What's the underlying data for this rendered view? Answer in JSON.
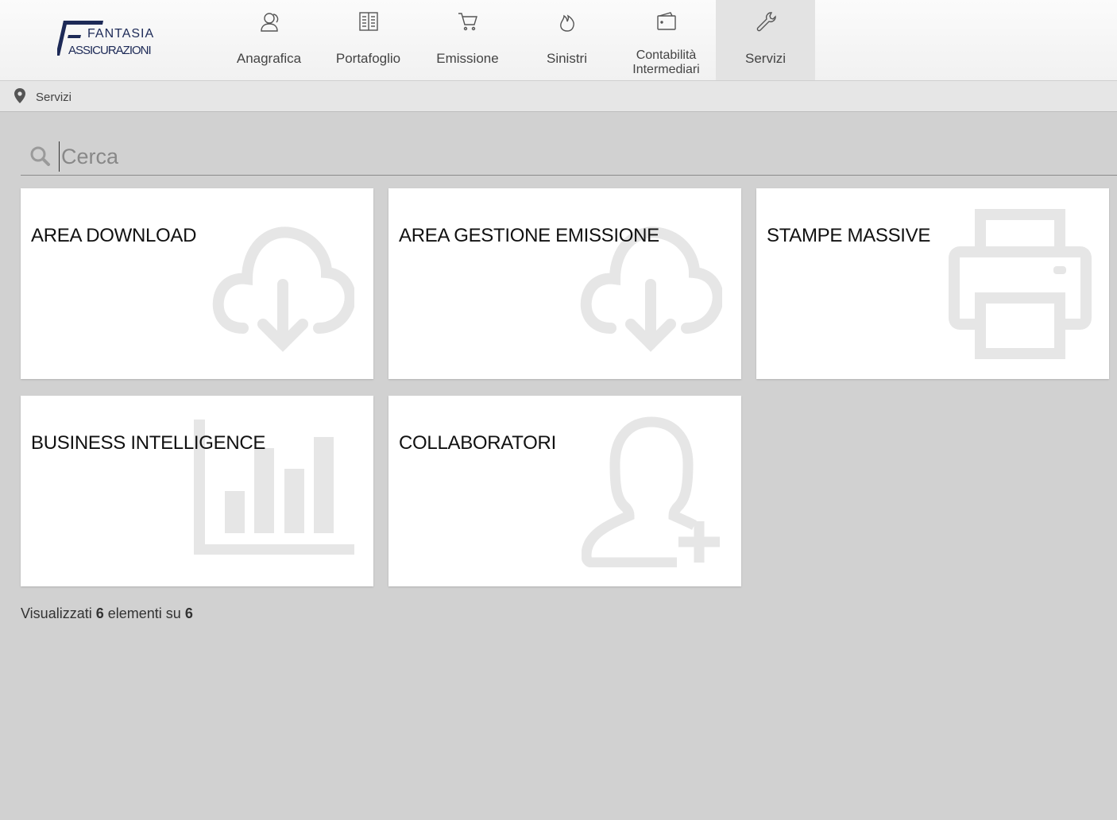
{
  "logo": {
    "line1": "FANTASIA",
    "line2": "ASSICURAZIONI"
  },
  "nav": {
    "items": [
      {
        "label": "Anagrafica",
        "icon": "users-icon"
      },
      {
        "label": "Portafoglio",
        "icon": "book-icon"
      },
      {
        "label": "Emissione",
        "icon": "cart-icon"
      },
      {
        "label": "Sinistri",
        "icon": "fire-icon"
      },
      {
        "label": "Contabilità\nIntermediari",
        "icon": "wallet-icon"
      },
      {
        "label": "Servizi",
        "icon": "wrench-icon",
        "active": true
      }
    ]
  },
  "breadcrumb": {
    "label": "Servizi"
  },
  "search": {
    "placeholder": "Cerca",
    "value": ""
  },
  "cards": [
    {
      "title": "AREA DOWNLOAD",
      "icon": "cloud-download-icon"
    },
    {
      "title": "AREA GESTIONE EMISSIONE",
      "icon": "cloud-download-icon"
    },
    {
      "title": "STAMPE MASSIVE",
      "icon": "printer-icon"
    },
    {
      "title": "BUSINESS INTELLIGENCE",
      "icon": "bar-chart-icon"
    },
    {
      "title": "COLLABORATORI",
      "icon": "user-add-icon"
    }
  ],
  "footer": {
    "prefix": "Visualizzati",
    "shown": "6",
    "middle": "elementi su",
    "total": "6"
  },
  "colors": {
    "background": "#d1d1d1",
    "card": "#ffffff",
    "icon_watermark": "#e6e6e6",
    "brand": "#1d2a57"
  }
}
